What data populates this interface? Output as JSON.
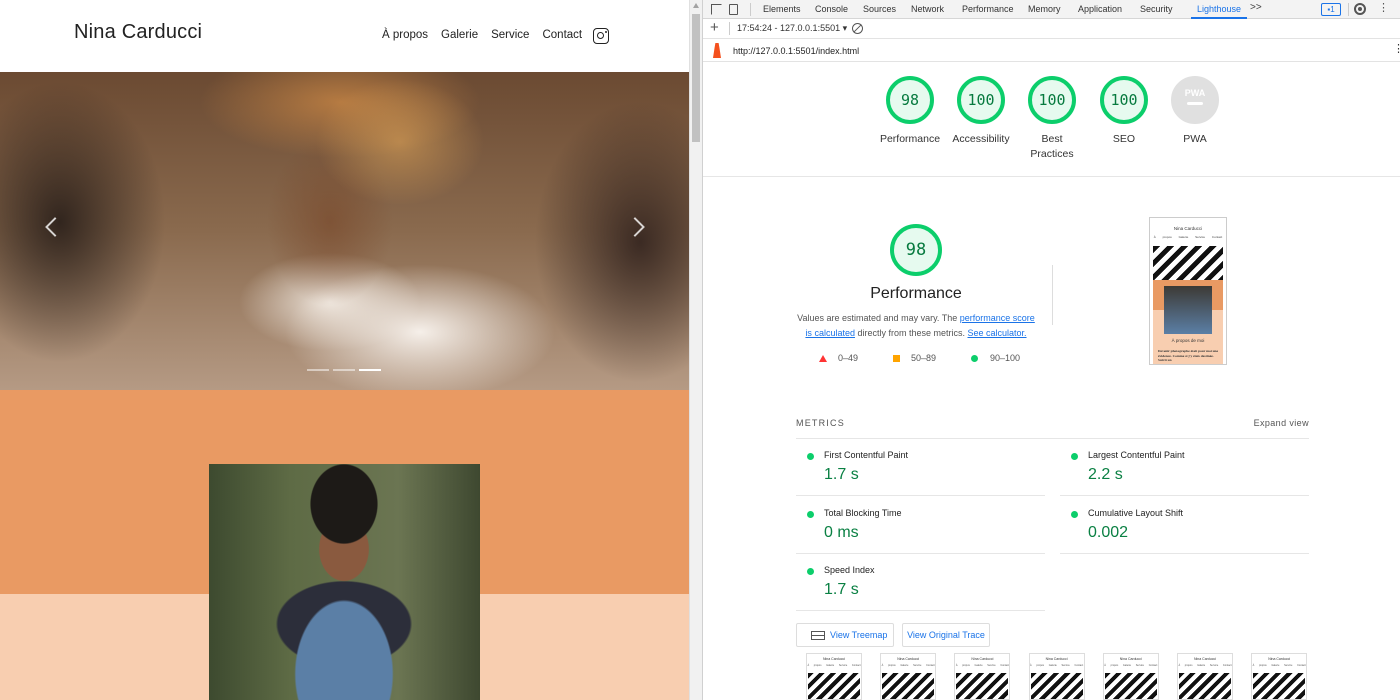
{
  "site": {
    "brand": "Nina Carducci",
    "nav": [
      "À propos",
      "Galerie",
      "Service",
      "Contact"
    ],
    "carousel": {
      "slides": 3,
      "active_slide": 3
    }
  },
  "devtools": {
    "tabs": [
      "Elements",
      "Console",
      "Sources",
      "Network",
      "Performance",
      "Memory",
      "Application",
      "Security",
      "Lighthouse"
    ],
    "active_tab": "Lighthouse",
    "more_tabs": ">>",
    "issues_badge": "1",
    "report_select": "17:54:24 - 127.0.0.1:5501 ▾",
    "url": "http://127.0.0.1:5501/index.html",
    "scores": [
      {
        "label": "Performance",
        "value": "98"
      },
      {
        "label": "Accessibility",
        "value": "100"
      },
      {
        "label": "Best Practices",
        "value": "100"
      },
      {
        "label": "SEO",
        "value": "100"
      },
      {
        "label": "PWA",
        "value": "PWA"
      }
    ],
    "performance": {
      "score": "98",
      "title": "Performance",
      "desc_prefix": "Values are estimated and may vary. The ",
      "desc_link1": "performance score is calculated",
      "desc_mid": " directly from these metrics. ",
      "desc_link2": "See calculator.",
      "legend": [
        "0–49",
        "50–89",
        "90–100"
      ]
    },
    "screenshot": {
      "title": "Nina Carducci",
      "nav": "À propos Galerie Service Contact",
      "about": "À propos de moi",
      "text": "Devenir photographe était pour moi une évidence. Comme si j'y étais destinée. Suivit un"
    },
    "metrics": {
      "title": "METRICS",
      "expand": "Expand view",
      "items": [
        {
          "label": "First Contentful Paint",
          "value": "1.7 s"
        },
        {
          "label": "Largest Contentful Paint",
          "value": "2.2 s"
        },
        {
          "label": "Total Blocking Time",
          "value": "0 ms"
        },
        {
          "label": "Cumulative Layout Shift",
          "value": "0.002"
        },
        {
          "label": "Speed Index",
          "value": "1.7 s"
        }
      ]
    },
    "buttons": {
      "treemap": "View Treemap",
      "trace": "View Original Trace"
    },
    "filmstrip": {
      "title": "Nina Carducci",
      "nav": "À propos Galerie Service Contact",
      "frames": 7
    }
  },
  "colors": {
    "pass": "#0cce6b",
    "average": "#ffa400",
    "fail": "#ff3333",
    "accent": "#1a73e8",
    "about_orange": "#e99a63",
    "about_peach": "#f8ceb0"
  }
}
